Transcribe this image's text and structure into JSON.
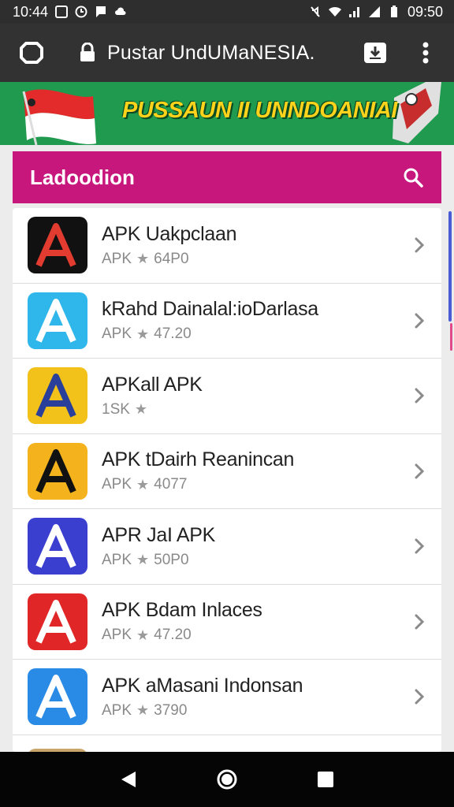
{
  "status_bar": {
    "time_left": "10:44",
    "time_right": "09:50",
    "icons_left": [
      "gallery-icon",
      "clock-icon",
      "flag-icon",
      "cloud-icon"
    ],
    "icons_right": [
      "mute-icon",
      "wifi-icon",
      "signal-icon",
      "signal-icon",
      "battery-icon"
    ]
  },
  "toolbar": {
    "url_text": "Pustar UndUMaNESIA.",
    "home_icon": "tab-home-icon",
    "lock_icon": "lock-icon",
    "download_icon": "download-icon",
    "menu_icon": "more-vert-icon"
  },
  "banner": {
    "title": "PUSSAUN II UNNDOANIAI"
  },
  "search_header": {
    "title": "Ladoodion",
    "search_icon": "search-icon",
    "color": "#c8177c"
  },
  "apps": [
    {
      "name": "APK Uakpclaan",
      "meta_prefix": "APK",
      "rating": "64P0",
      "show_star": true,
      "icon_bg": "#111111",
      "icon_fg": "#e23b30"
    },
    {
      "name": "kRahd Dainalal:ioDarlasa",
      "meta_prefix": "APK",
      "rating": "47.20",
      "show_star": true,
      "icon_bg": "#2fb6ea",
      "icon_fg": "#ffffff"
    },
    {
      "name": "APKall APK",
      "meta_prefix": "1SK",
      "rating": "",
      "show_star": true,
      "icon_bg": "#f2c21a",
      "icon_fg": "#2a3f9a"
    },
    {
      "name": "APK tDairh Reanincan",
      "meta_prefix": "APK",
      "rating": "4077",
      "show_star": true,
      "icon_bg": "#f4b21c",
      "icon_fg": "#111111"
    },
    {
      "name": "APR JaI APK",
      "meta_prefix": "APK",
      "rating": "50P0",
      "show_star": true,
      "icon_bg": "#3a3fd0",
      "icon_fg": "#ffffff"
    },
    {
      "name": "APK Bdam Inlaces",
      "meta_prefix": "APK",
      "rating": "47.20",
      "show_star": true,
      "icon_bg": "#e02626",
      "icon_fg": "#ffffff"
    },
    {
      "name": "APK aMasani Indonsan",
      "meta_prefix": "APK",
      "rating": "3790",
      "show_star": true,
      "icon_bg": "#2a8be6",
      "icon_fg": "#ffffff"
    }
  ],
  "navbar": {
    "back_icon": "back-icon",
    "home_icon": "home-icon",
    "recents_icon": "recents-icon"
  }
}
